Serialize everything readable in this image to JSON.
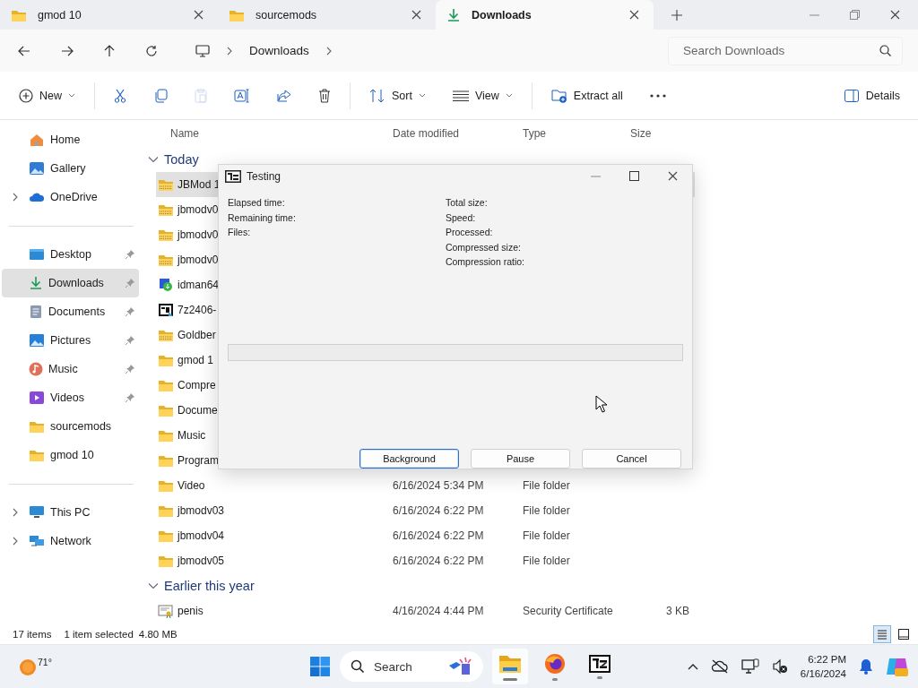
{
  "tabs": [
    {
      "label": "gmod 10",
      "kind": "folder",
      "selected": false
    },
    {
      "label": "sourcemods",
      "kind": "folder",
      "selected": false
    },
    {
      "label": "Downloads",
      "kind": "download",
      "selected": true
    }
  ],
  "address_bar": {
    "breadcrumb": [
      "Downloads"
    ]
  },
  "search": {
    "placeholder": "Search Downloads"
  },
  "command_bar": {
    "items": [
      {
        "kind": "menu",
        "label": "New",
        "disabled": false
      },
      {
        "kind": "icon",
        "disabled": false
      },
      {
        "kind": "icon",
        "disabled": false
      },
      {
        "kind": "icon",
        "disabled": true
      },
      {
        "kind": "icon",
        "disabled": false
      },
      {
        "kind": "icon",
        "disabled": false
      },
      {
        "kind": "icon",
        "disabled": false
      },
      {
        "kind": "menu",
        "label": "Sort",
        "disabled": false
      },
      {
        "kind": "menu",
        "label": "View",
        "disabled": false
      },
      {
        "kind": "button",
        "label": "Extract all",
        "disabled": false
      },
      {
        "kind": "icon",
        "disabled": false
      }
    ],
    "details": {
      "label": "Details"
    }
  },
  "sidebar": {
    "groups": [
      {
        "items": [
          {
            "label": "Home",
            "expandable": false,
            "pinned": false,
            "selected": false
          },
          {
            "label": "Gallery",
            "expandable": false,
            "pinned": false,
            "selected": false
          },
          {
            "label": "OneDrive",
            "expandable": true,
            "pinned": false,
            "selected": false
          }
        ]
      },
      {
        "items": [
          {
            "label": "Desktop",
            "expandable": false,
            "pinned": true,
            "selected": false
          },
          {
            "label": "Downloads",
            "expandable": false,
            "pinned": true,
            "selected": true
          },
          {
            "label": "Documents",
            "expandable": false,
            "pinned": true,
            "selected": false
          },
          {
            "label": "Pictures",
            "expandable": false,
            "pinned": true,
            "selected": false
          },
          {
            "label": "Music",
            "expandable": false,
            "pinned": true,
            "selected": false
          },
          {
            "label": "Videos",
            "expandable": false,
            "pinned": true,
            "selected": false
          },
          {
            "label": "sourcemods",
            "expandable": false,
            "pinned": false,
            "selected": false
          },
          {
            "label": "gmod 10",
            "expandable": false,
            "pinned": false,
            "selected": false
          }
        ]
      },
      {
        "items": [
          {
            "label": "This PC",
            "expandable": true,
            "pinned": false,
            "selected": false
          },
          {
            "label": "Network",
            "expandable": true,
            "pinned": false,
            "selected": false
          }
        ]
      }
    ]
  },
  "file_list": {
    "columns": [
      "Name",
      "Date modified",
      "Type",
      "Size"
    ],
    "groups": [
      {
        "label": "Today",
        "expanded": true,
        "rows": [
          {
            "name": "JBMod 1",
            "kind": "archive",
            "selected": true
          },
          {
            "name": "jbmodv0",
            "kind": "archive",
            "selected": false
          },
          {
            "name": "jbmodv0",
            "kind": "archive",
            "selected": false
          },
          {
            "name": "jbmodv0",
            "kind": "archive",
            "selected": false
          },
          {
            "name": "idman64",
            "kind": "installer",
            "selected": false
          },
          {
            "name": "7z2406-",
            "kind": "app",
            "selected": false
          },
          {
            "name": "Goldber",
            "kind": "archive",
            "selected": false
          },
          {
            "name": "gmod 1",
            "kind": "folder",
            "selected": false
          },
          {
            "name": "Compre",
            "kind": "folder",
            "selected": false
          },
          {
            "name": "Docume",
            "kind": "folder",
            "selected": false
          },
          {
            "name": "Music",
            "kind": "folder",
            "selected": false
          },
          {
            "name": "Program",
            "kind": "folder",
            "selected": false
          },
          {
            "name": "Video",
            "kind": "folder",
            "selected": false,
            "date": "6/16/2024 5:34 PM",
            "type": "File folder"
          },
          {
            "name": "jbmodv03",
            "kind": "folder",
            "selected": false,
            "date": "6/16/2024 6:22 PM",
            "type": "File folder"
          },
          {
            "name": "jbmodv04",
            "kind": "folder",
            "selected": false,
            "date": "6/16/2024 6:22 PM",
            "type": "File folder"
          },
          {
            "name": "jbmodv05",
            "kind": "folder",
            "selected": false,
            "date": "6/16/2024 6:22 PM",
            "type": "File folder"
          }
        ]
      },
      {
        "label": "Earlier this year",
        "expanded": true,
        "rows": [
          {
            "name": "penis",
            "kind": "certificate",
            "selected": false,
            "date": "4/16/2024 4:44 PM",
            "type": "Security Certificate",
            "size": "3 KB"
          }
        ]
      }
    ]
  },
  "status_bar": {
    "item_count": "17 items",
    "selection": "1 item selected",
    "selection_size": "4.80 MB",
    "view_modes": [
      {
        "selected": true
      },
      {
        "selected": false
      }
    ]
  },
  "dialog": {
    "title": "Testing",
    "left_fields": [
      "Elapsed time:",
      "Remaining time:",
      "Files:"
    ],
    "right_fields": [
      "Total size:",
      "Speed:",
      "Processed:",
      "Compressed size:",
      "Compression ratio:"
    ],
    "progress": {
      "level": 0
    },
    "buttons": [
      {
        "label": "Background",
        "focused": true
      },
      {
        "label": "Pause",
        "focused": false
      },
      {
        "label": "Cancel",
        "focused": false
      }
    ]
  },
  "taskbar": {
    "weather": "71°",
    "search": {
      "placeholder": "Search"
    },
    "apps": [
      {
        "active": true
      },
      {
        "active": false
      },
      {
        "active": false
      }
    ],
    "clock": {
      "time": "6:22 PM",
      "date": "6/16/2024"
    }
  }
}
